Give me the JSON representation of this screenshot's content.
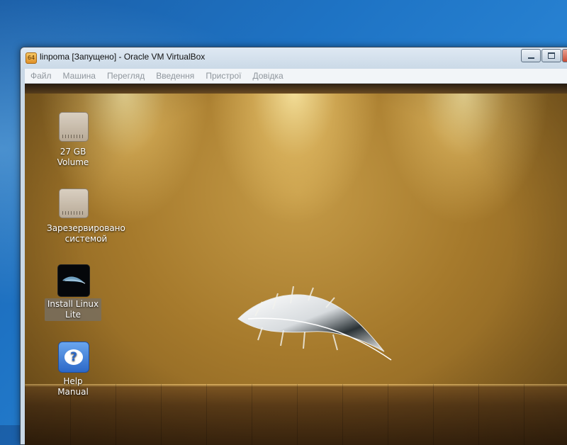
{
  "window": {
    "title": "linpoma [Запущено] - Oracle VM VirtualBox",
    "app_icon_text": "64"
  },
  "menu": [
    {
      "label": "Файл"
    },
    {
      "label": "Машина"
    },
    {
      "label": "Перегляд"
    },
    {
      "label": "Введення"
    },
    {
      "label": "Пристрої"
    },
    {
      "label": "Довідка"
    }
  ],
  "desktop_icons": [
    {
      "label": "27 GB Volume",
      "icon": "drive-icon"
    },
    {
      "label": "Зарезервировано системой",
      "icon": "drive-icon"
    },
    {
      "label": "Install Linux Lite",
      "icon": "linux-lite-icon"
    },
    {
      "label": "Help Manual",
      "icon": "help-icon"
    }
  ],
  "colors": {
    "host_desktop": "#1e73c4",
    "wallpaper_gold": "#a67a2c",
    "selection": "#786e5f"
  }
}
